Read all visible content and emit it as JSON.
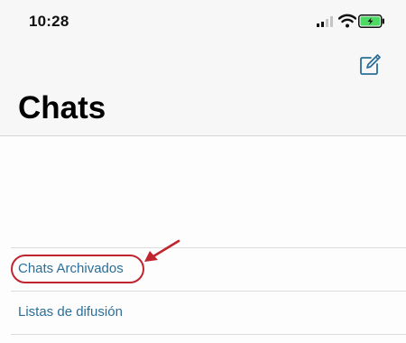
{
  "status_bar": {
    "time": "10:28",
    "icons": [
      "signal-icon",
      "wifi-icon",
      "battery-icon"
    ]
  },
  "header": {
    "compose_icon": "compose-icon",
    "title": "Chats"
  },
  "list": {
    "items": [
      {
        "label": "Chats Archivados",
        "highlighted": true
      },
      {
        "label": "Listas de difusión",
        "highlighted": false
      }
    ]
  },
  "colors": {
    "accent": "#2a6f9a",
    "annotation": "#c0242f",
    "header_bg": "#f7f7f7"
  }
}
